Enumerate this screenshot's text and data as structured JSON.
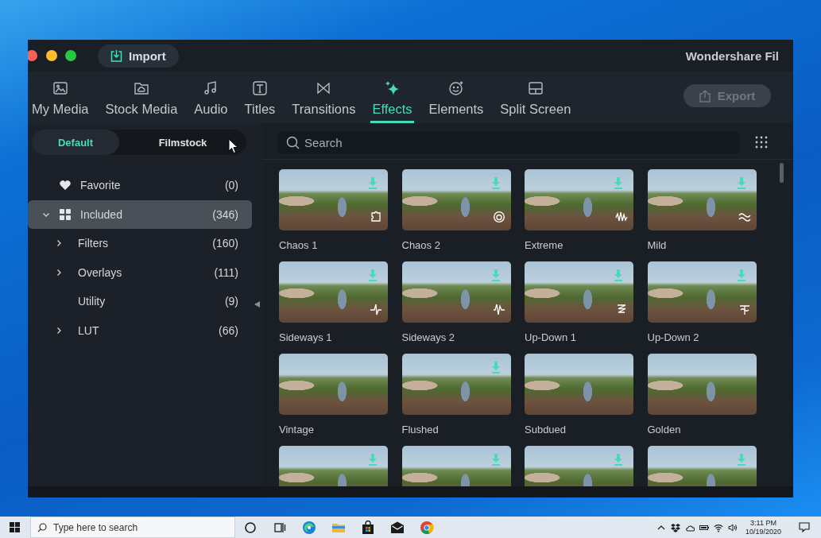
{
  "window": {
    "title": "Wondershare Fil"
  },
  "import_button": {
    "label": "Import"
  },
  "tabs": [
    {
      "label": "My Media",
      "selected": false
    },
    {
      "label": "Stock Media",
      "selected": false
    },
    {
      "label": "Audio",
      "selected": false
    },
    {
      "label": "Titles",
      "selected": false
    },
    {
      "label": "Transitions",
      "selected": false
    },
    {
      "label": "Effects",
      "selected": true
    },
    {
      "label": "Elements",
      "selected": false
    },
    {
      "label": "Split Screen",
      "selected": false
    }
  ],
  "export_button": {
    "label": "Export",
    "disabled": true
  },
  "library_switch": [
    {
      "label": "Default",
      "selected": true
    },
    {
      "label": "Filmstock",
      "selected": false
    }
  ],
  "tree": [
    {
      "kind": "favorite",
      "label": "Favorite",
      "count": "(0)",
      "selected": false
    },
    {
      "kind": "library",
      "label": "Included",
      "count": "(346)",
      "selected": true,
      "expanded": true,
      "children": [
        {
          "label": "Filters",
          "count": "(160)",
          "selected": false,
          "expanded": false
        },
        {
          "label": "Overlays",
          "count": "(111)",
          "selected": false,
          "expanded": false
        },
        {
          "label": "Utility",
          "count": "(9)",
          "selected": false
        },
        {
          "label": "LUT",
          "count": "(66)",
          "selected": false,
          "expanded": false
        }
      ]
    }
  ],
  "search": {
    "placeholder": "Search"
  },
  "effects": [
    {
      "name": "Chaos 1",
      "downloadable": true,
      "kind": "puzzle"
    },
    {
      "name": "Chaos 2",
      "downloadable": true,
      "kind": "ring"
    },
    {
      "name": "Extreme",
      "downloadable": true,
      "kind": "zigzag"
    },
    {
      "name": "Mild",
      "downloadable": true,
      "kind": "wave"
    },
    {
      "name": "Sideways 1",
      "downloadable": true,
      "kind": "pulse"
    },
    {
      "name": "Sideways 2",
      "downloadable": true,
      "kind": "spike"
    },
    {
      "name": "Up-Down 1",
      "downloadable": true,
      "kind": "stack"
    },
    {
      "name": "Up-Down 2",
      "downloadable": true,
      "kind": "tee"
    },
    {
      "name": "Vintage",
      "downloadable": false,
      "kind": "plain"
    },
    {
      "name": "Flushed",
      "downloadable": true,
      "kind": "plain"
    },
    {
      "name": "Subdued",
      "downloadable": false,
      "kind": "plain"
    },
    {
      "name": "Golden",
      "downloadable": false,
      "kind": "plain"
    },
    {
      "downloadable": true,
      "kind": "plain"
    },
    {
      "downloadable": true,
      "kind": "plain"
    },
    {
      "downloadable": true,
      "kind": "plain"
    },
    {
      "downloadable": true,
      "kind": "plain"
    }
  ],
  "taskbar": {
    "search_placeholder": "Type here to search",
    "time": "3:11 PM",
    "date": "10/19/2020"
  }
}
